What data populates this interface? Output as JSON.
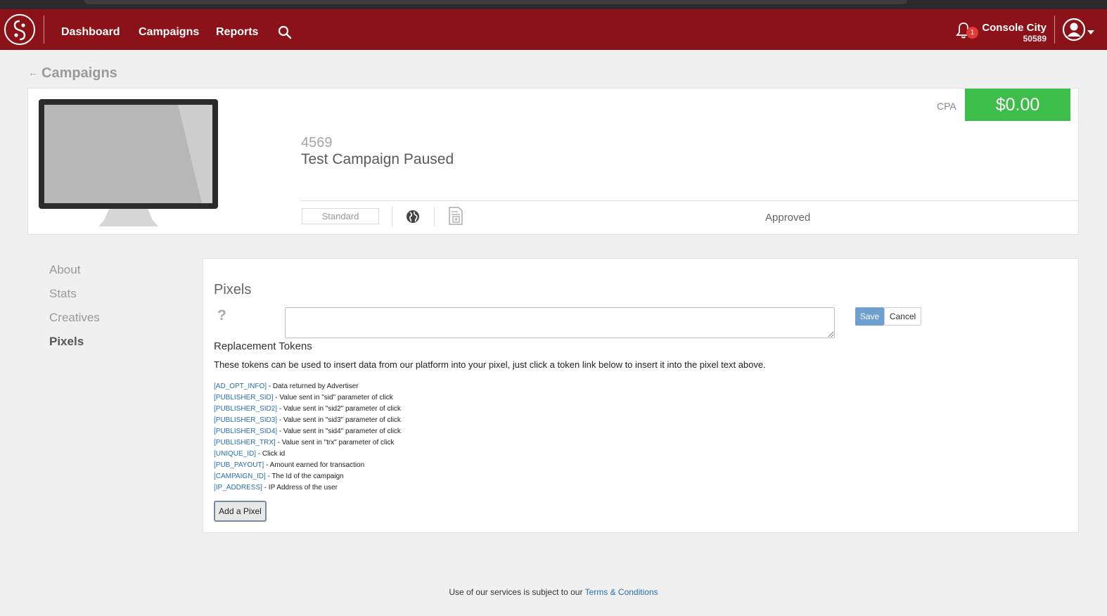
{
  "nav": {
    "links": [
      "Dashboard",
      "Campaigns",
      "Reports"
    ],
    "notification_count": "1",
    "account_name": "Console City",
    "account_id": "50589"
  },
  "breadcrumb": {
    "back_label": "Campaigns"
  },
  "campaign": {
    "cpa_label": "CPA",
    "cpa_value": "$0.00",
    "id": "4569",
    "name": "Test Campaign Paused",
    "type": "Standard",
    "status": "Approved"
  },
  "sidebar": {
    "items": [
      {
        "label": "About",
        "active": false
      },
      {
        "label": "Stats",
        "active": false
      },
      {
        "label": "Creatives",
        "active": false
      },
      {
        "label": "Pixels",
        "active": true
      }
    ]
  },
  "pixels": {
    "title": "Pixels",
    "help": "?",
    "input_value": "",
    "save_label": "Save",
    "cancel_label": "Cancel",
    "tokens_title": "Replacement Tokens",
    "tokens_description": "These tokens can be used to insert data from our platform into your pixel, just click a token link below to insert it into the pixel text above.",
    "tokens": [
      {
        "token": "[AD_OPT_INFO]",
        "desc": " - Data returned by Advertiser"
      },
      {
        "token": "[PUBLISHER_SID]",
        "desc": " - Value sent in \"sid\" parameter of click"
      },
      {
        "token": "[PUBLISHER_SID2]",
        "desc": " - Value sent in \"sid2\" parameter of click"
      },
      {
        "token": "[PUBLISHER_SID3]",
        "desc": " - Value sent in \"sid3\" parameter of click"
      },
      {
        "token": "[PUBLISHER_SID4]",
        "desc": " - Value sent in \"sid4\" parameter of click"
      },
      {
        "token": "[PUBLISHER_TRX]",
        "desc": " - Value sent in \"trx\" parameter of click"
      },
      {
        "token": "[UNIQUE_ID]",
        "desc": " - Click id"
      },
      {
        "token": "[PUB_PAYOUT]",
        "desc": " - Amount earned for transaction"
      },
      {
        "token": "[CAMPAIGN_ID]",
        "desc": " - The Id of the campaign"
      },
      {
        "token": "[IP_ADDRESS]",
        "desc": " - IP Address of the user"
      }
    ],
    "add_label": "Add a Pixel"
  },
  "footer": {
    "text": "Use of our services is subject to our ",
    "link": "Terms & Conditions"
  },
  "colors": {
    "nav_bg": "#8b1218",
    "cpa_green": "#3dbd4a",
    "link_blue": "#2a6fb0",
    "save_blue": "#6f9fcf"
  },
  "icons": [
    "logo-icon",
    "search-icon",
    "bell-icon",
    "user-avatar-icon",
    "back-arrow-icon",
    "globe-icon",
    "document-icon",
    "help-icon"
  ]
}
